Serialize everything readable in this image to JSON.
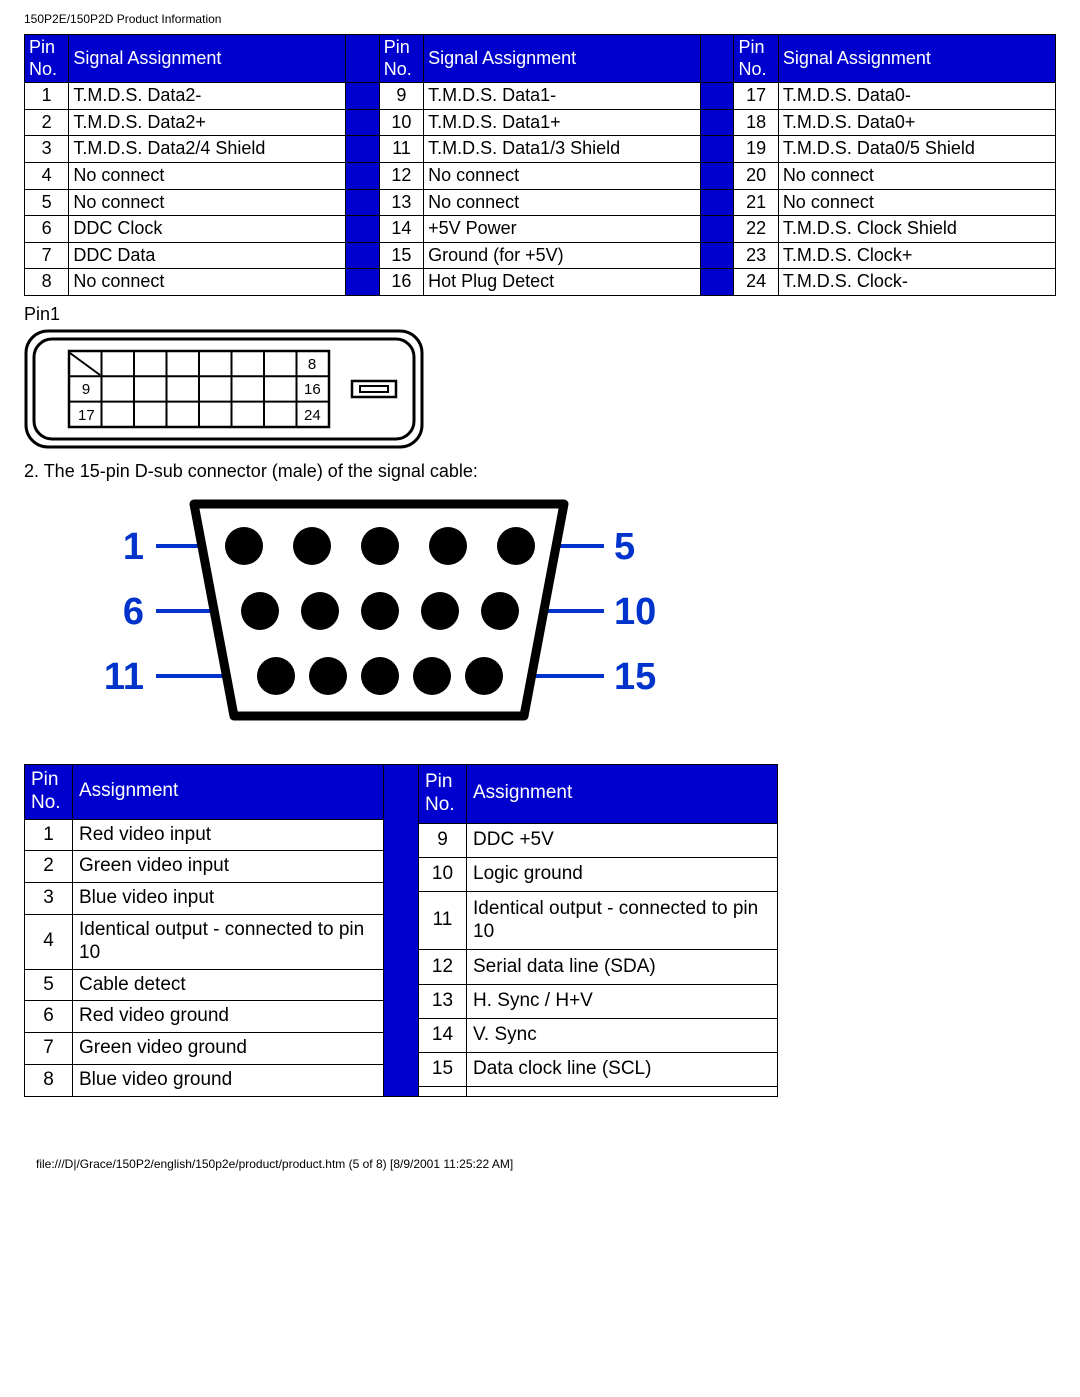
{
  "doc_title": "150P2E/150P2D Product Information",
  "dvi_table": {
    "header_pin": "Pin No.",
    "header_sig": "Signal Assignment",
    "groups": [
      [
        {
          "pin": "1",
          "sig": "T.M.D.S. Data2-"
        },
        {
          "pin": "2",
          "sig": "T.M.D.S. Data2+"
        },
        {
          "pin": "3",
          "sig": "T.M.D.S. Data2/4 Shield"
        },
        {
          "pin": "4",
          "sig": "No connect"
        },
        {
          "pin": "5",
          "sig": "No connect"
        },
        {
          "pin": "6",
          "sig": "DDC Clock"
        },
        {
          "pin": "7",
          "sig": "DDC Data"
        },
        {
          "pin": "8",
          "sig": "No connect"
        }
      ],
      [
        {
          "pin": "9",
          "sig": "T.M.D.S. Data1-"
        },
        {
          "pin": "10",
          "sig": "T.M.D.S. Data1+"
        },
        {
          "pin": "11",
          "sig": "T.M.D.S. Data1/3 Shield"
        },
        {
          "pin": "12",
          "sig": "No connect"
        },
        {
          "pin": "13",
          "sig": "No connect"
        },
        {
          "pin": "14",
          "sig": "+5V Power"
        },
        {
          "pin": "15",
          "sig": "Ground (for +5V)"
        },
        {
          "pin": "16",
          "sig": "Hot Plug Detect"
        }
      ],
      [
        {
          "pin": "17",
          "sig": "T.M.D.S. Data0-"
        },
        {
          "pin": "18",
          "sig": "T.M.D.S. Data0+"
        },
        {
          "pin": "19",
          "sig": "T.M.D.S. Data0/5 Shield"
        },
        {
          "pin": "20",
          "sig": "No connect"
        },
        {
          "pin": "21",
          "sig": "No connect"
        },
        {
          "pin": "22",
          "sig": "T.M.D.S. Clock Shield"
        },
        {
          "pin": "23",
          "sig": "T.M.D.S. Clock+"
        },
        {
          "pin": "24",
          "sig": "T.M.D.S. Clock-"
        }
      ]
    ]
  },
  "pin1_label": "Pin1",
  "dvi_diagram": {
    "labels": {
      "r1": "8",
      "r2a": "9",
      "r2b": "16",
      "r3a": "17",
      "r3b": "24"
    }
  },
  "dsub_caption": "2. The 15-pin D-sub connector (male) of the signal cable:",
  "dsub_diagram": {
    "left": {
      "top": "1",
      "mid": "6",
      "bot": "11"
    },
    "right": {
      "top": "5",
      "mid": "10",
      "bot": "15"
    }
  },
  "dsub_table": {
    "header_pin": "Pin No.",
    "header_sig": "Assignment",
    "left": [
      {
        "pin": "1",
        "sig": "Red video input"
      },
      {
        "pin": "2",
        "sig": "Green video input"
      },
      {
        "pin": "3",
        "sig": "Blue video input"
      },
      {
        "pin": "4",
        "sig": "Identical output - connected to pin 10"
      },
      {
        "pin": "5",
        "sig": "Cable detect"
      },
      {
        "pin": "6",
        "sig": "Red video ground"
      },
      {
        "pin": "7",
        "sig": "Green video ground"
      },
      {
        "pin": "8",
        "sig": "Blue video ground"
      }
    ],
    "right": [
      {
        "pin": "9",
        "sig": "DDC +5V"
      },
      {
        "pin": "10",
        "sig": "Logic ground"
      },
      {
        "pin": "11",
        "sig": "Identical output - connected to pin 10"
      },
      {
        "pin": "12",
        "sig": "Serial data line (SDA)"
      },
      {
        "pin": "13",
        "sig": "H. Sync / H+V"
      },
      {
        "pin": "14",
        "sig": "V. Sync"
      },
      {
        "pin": "15",
        "sig": "Data clock line (SCL)"
      },
      {
        "pin": "",
        "sig": ""
      }
    ]
  },
  "footer": "file:///D|/Grace/150P2/english/150p2e/product/product.htm (5 of 8) [8/9/2001 11:25:22 AM]"
}
